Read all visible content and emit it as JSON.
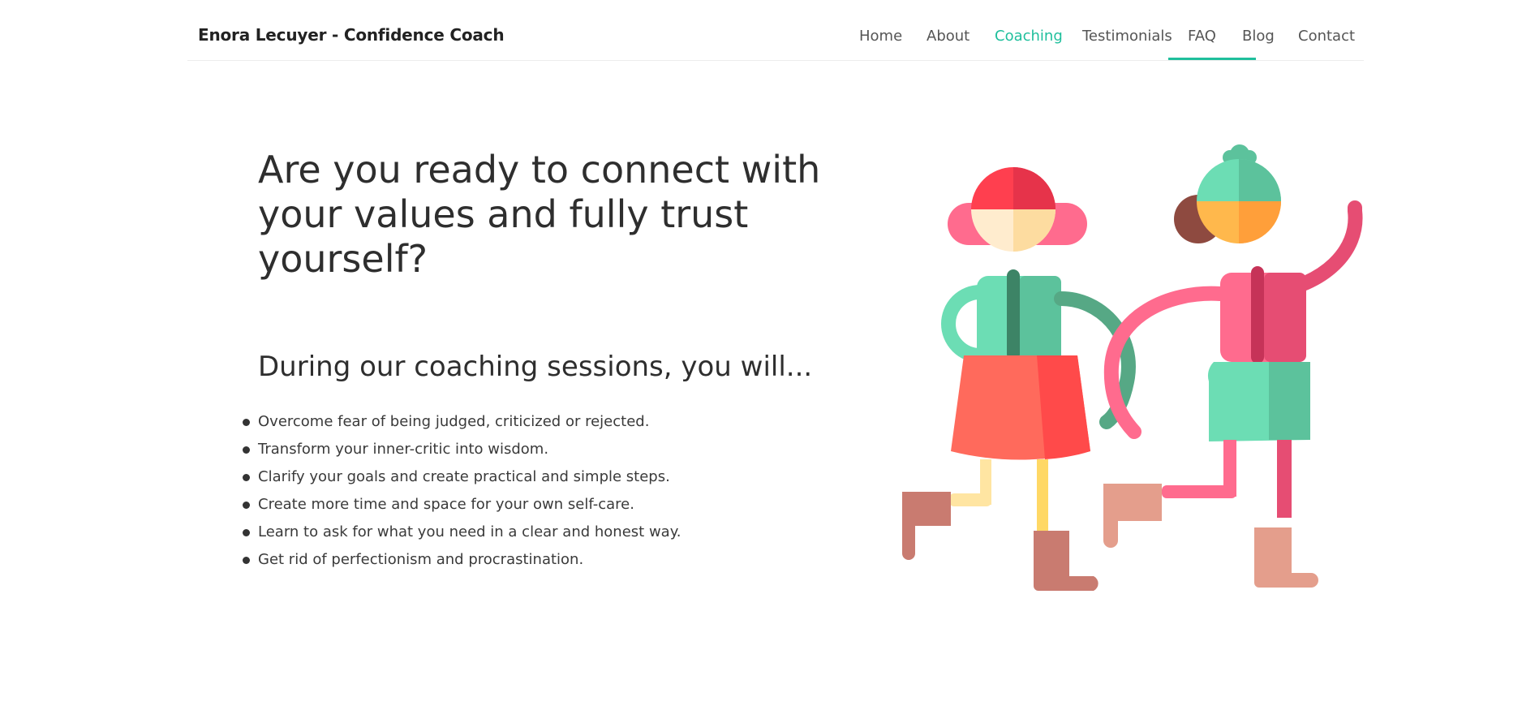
{
  "header": {
    "brand": "Enora Lecuyer - Confidence Coach",
    "nav": [
      {
        "label": "Home"
      },
      {
        "label": "About"
      },
      {
        "label": "Coaching",
        "active": true
      },
      {
        "label": "Testimonials"
      },
      {
        "label": "FAQ"
      },
      {
        "label": "Blog"
      },
      {
        "label": "Contact"
      }
    ]
  },
  "hero": {
    "title": "Are you ready to connect with your values and fully trust yourself?"
  },
  "coaching": {
    "heading": "During our coaching sessions, you will...",
    "benefits": [
      "Overcome fear of being judged, criticized or rejected.",
      "Transform your inner-critic into wisdom.",
      "Clarify your goals and create practical and simple steps.",
      "Create more time and space for your own self-care.",
      "Learn to ask for what you need in a clear and honest way.",
      "Get rid of perfectionism and procrastination."
    ]
  },
  "colors": {
    "accent": "#1fbf9c",
    "text": "#2e2e2e"
  }
}
